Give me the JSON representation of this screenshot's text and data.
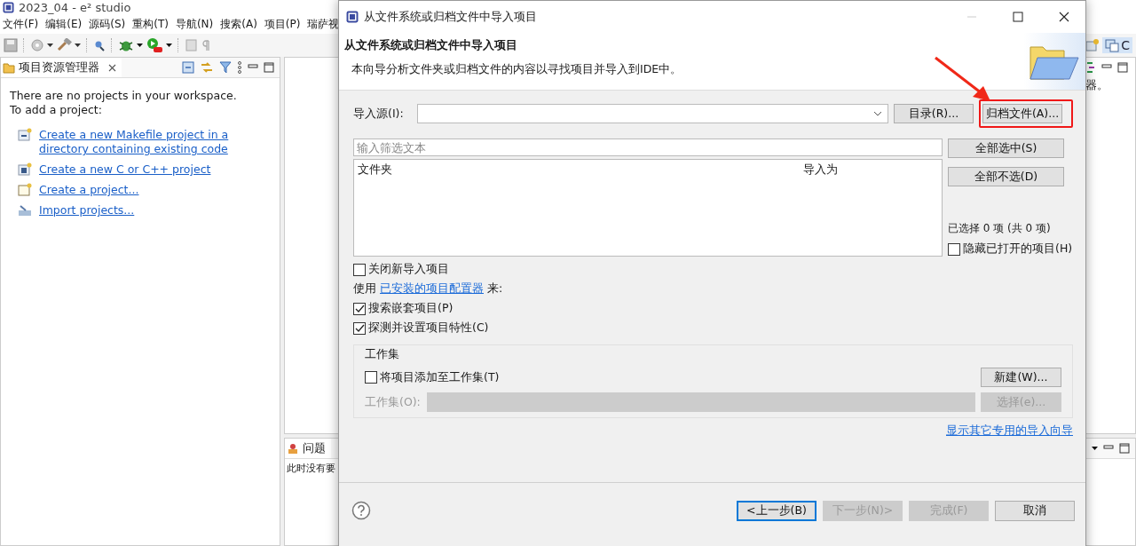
{
  "ide": {
    "title": "2023_04 - e² studio",
    "menu": [
      "文件(F)",
      "编辑(E)",
      "源码(S)",
      "重构(T)",
      "导航(N)",
      "搜索(A)",
      "项目(P)",
      "瑞萨视"
    ],
    "perspective_label": "C",
    "explorer": {
      "tab": "项目资源管理器",
      "message": [
        "There are no projects in your workspace.",
        "To add a project:"
      ],
      "links": [
        {
          "kind": "makefile",
          "label": "Create a new Makefile project in a directory containing existing code"
        },
        {
          "kind": "cproject",
          "label": "Create a new C or C++ project"
        },
        {
          "kind": "project",
          "label": "Create a project..."
        },
        {
          "kind": "import",
          "label": "Import projects..."
        }
      ]
    },
    "right_fragment": "器。",
    "bottom_panel": {
      "tab": "问题",
      "message": "此时没有要"
    }
  },
  "dialog": {
    "title": "从文件系统或归档文件中导入项目",
    "heading": "从文件系统或归档文件中导入项目",
    "description": "本向导分析文件夹或归档文件的内容以寻找项目并导入到IDE中。",
    "source_label": "导入源(I):",
    "source_buttons": [
      {
        "label": "目录(R)...",
        "highlighted": false
      },
      {
        "label": "归档文件(A)...",
        "highlighted": true
      }
    ],
    "filter": {
      "placeholder": "输入筛选文本"
    },
    "table": {
      "columns": [
        "文件夹",
        "导入为"
      ]
    },
    "side_buttons": [
      "全部选中(S)",
      "全部不选(D)"
    ],
    "selection_count": "已选择 0 项  (共 0 项)",
    "hide_open": {
      "label": "隐藏已打开的项目(H)",
      "checked": false
    },
    "close_new": {
      "label": "关闭新导入项目",
      "checked": false
    },
    "configurator_line": {
      "prefix": "使用",
      "link": "已安装的项目配置器",
      "suffix": "来:"
    },
    "options": [
      {
        "label": "搜索嵌套项目(P)",
        "checked": true
      },
      {
        "label": "探测并设置项目特性(C)",
        "checked": true
      }
    ],
    "working_set": {
      "title": "工作集",
      "add": {
        "label": "将项目添加至工作集(T)",
        "checked": false
      },
      "new_button": "新建(W)...",
      "field_label": "工作集(O):",
      "disabled": true,
      "select_button": "选择(e)..."
    },
    "other_wizards_link": "显示其它专用的导入向导",
    "buttons": [
      {
        "label": "<上一步(B)",
        "disabled": false,
        "focused": true
      },
      {
        "label": "下一步(N)>",
        "disabled": true,
        "focused": false
      },
      {
        "label": "完成(F)",
        "disabled": true,
        "focused": false
      },
      {
        "label": "取消",
        "disabled": false,
        "focused": false
      }
    ]
  }
}
